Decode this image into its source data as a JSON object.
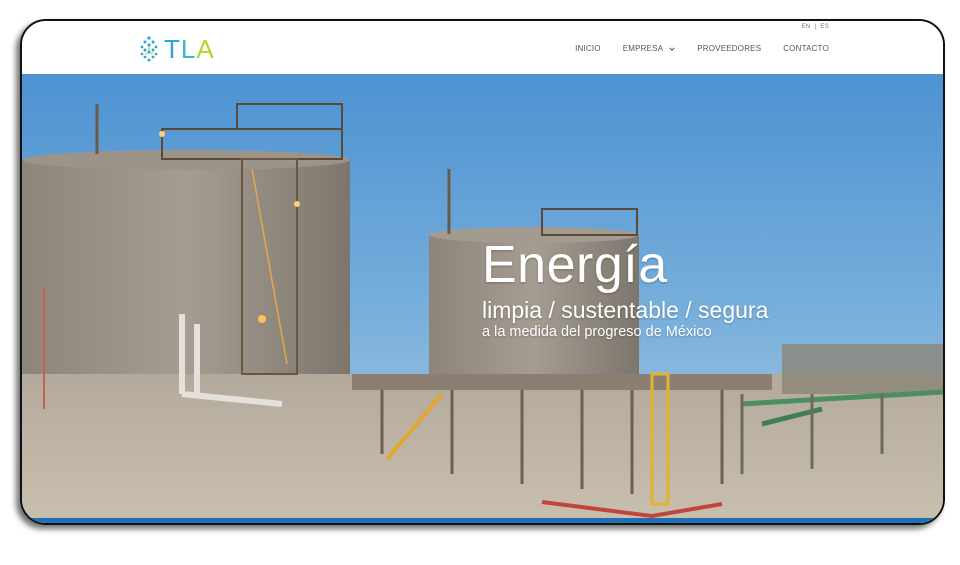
{
  "brand": {
    "logo_text": [
      "T",
      "L",
      "A"
    ],
    "logo_colors": [
      "#2ea3d6",
      "#39b9c5",
      "#b7d432"
    ]
  },
  "language": {
    "en": "EN",
    "separator": "|",
    "es": "ES"
  },
  "nav": {
    "items": [
      {
        "label": "INICIO"
      },
      {
        "label": "EMPRESA",
        "icon": "chevron-down-icon"
      },
      {
        "label": "PROVEEDORES"
      },
      {
        "label": "CONTACTO"
      }
    ]
  },
  "hero": {
    "title": "Energía",
    "subtitle": "limpia / sustentable / segura",
    "tagline": "a la medida del progreso de México"
  },
  "colors": {
    "accent": "#1f6fb6",
    "sky": "#5d9fd6"
  }
}
